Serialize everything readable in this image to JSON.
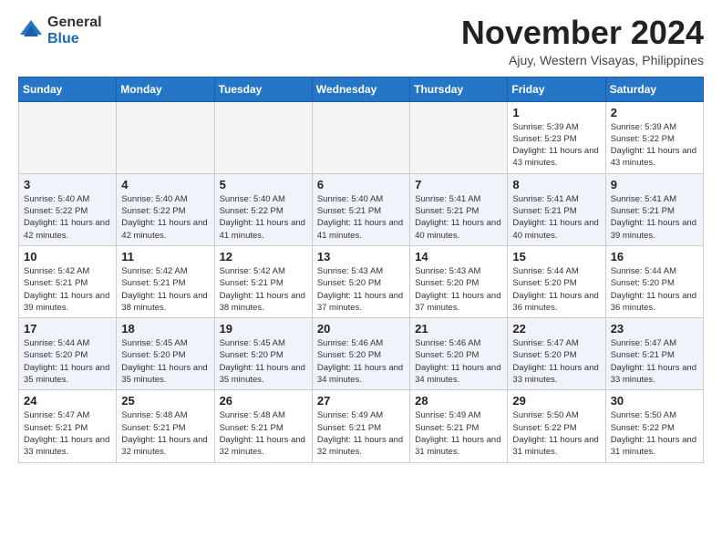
{
  "logo": {
    "general": "General",
    "blue": "Blue"
  },
  "header": {
    "month": "November 2024",
    "location": "Ajuy, Western Visayas, Philippines"
  },
  "weekdays": [
    "Sunday",
    "Monday",
    "Tuesday",
    "Wednesday",
    "Thursday",
    "Friday",
    "Saturday"
  ],
  "weeks": [
    [
      {
        "day": "",
        "empty": true
      },
      {
        "day": "",
        "empty": true
      },
      {
        "day": "",
        "empty": true
      },
      {
        "day": "",
        "empty": true
      },
      {
        "day": "",
        "empty": true
      },
      {
        "day": "1",
        "sunrise": "Sunrise: 5:39 AM",
        "sunset": "Sunset: 5:23 PM",
        "daylight": "Daylight: 11 hours and 43 minutes."
      },
      {
        "day": "2",
        "sunrise": "Sunrise: 5:39 AM",
        "sunset": "Sunset: 5:22 PM",
        "daylight": "Daylight: 11 hours and 43 minutes."
      }
    ],
    [
      {
        "day": "3",
        "sunrise": "Sunrise: 5:40 AM",
        "sunset": "Sunset: 5:22 PM",
        "daylight": "Daylight: 11 hours and 42 minutes."
      },
      {
        "day": "4",
        "sunrise": "Sunrise: 5:40 AM",
        "sunset": "Sunset: 5:22 PM",
        "daylight": "Daylight: 11 hours and 42 minutes."
      },
      {
        "day": "5",
        "sunrise": "Sunrise: 5:40 AM",
        "sunset": "Sunset: 5:22 PM",
        "daylight": "Daylight: 11 hours and 41 minutes."
      },
      {
        "day": "6",
        "sunrise": "Sunrise: 5:40 AM",
        "sunset": "Sunset: 5:21 PM",
        "daylight": "Daylight: 11 hours and 41 minutes."
      },
      {
        "day": "7",
        "sunrise": "Sunrise: 5:41 AM",
        "sunset": "Sunset: 5:21 PM",
        "daylight": "Daylight: 11 hours and 40 minutes."
      },
      {
        "day": "8",
        "sunrise": "Sunrise: 5:41 AM",
        "sunset": "Sunset: 5:21 PM",
        "daylight": "Daylight: 11 hours and 40 minutes."
      },
      {
        "day": "9",
        "sunrise": "Sunrise: 5:41 AM",
        "sunset": "Sunset: 5:21 PM",
        "daylight": "Daylight: 11 hours and 39 minutes."
      }
    ],
    [
      {
        "day": "10",
        "sunrise": "Sunrise: 5:42 AM",
        "sunset": "Sunset: 5:21 PM",
        "daylight": "Daylight: 11 hours and 39 minutes."
      },
      {
        "day": "11",
        "sunrise": "Sunrise: 5:42 AM",
        "sunset": "Sunset: 5:21 PM",
        "daylight": "Daylight: 11 hours and 38 minutes."
      },
      {
        "day": "12",
        "sunrise": "Sunrise: 5:42 AM",
        "sunset": "Sunset: 5:21 PM",
        "daylight": "Daylight: 11 hours and 38 minutes."
      },
      {
        "day": "13",
        "sunrise": "Sunrise: 5:43 AM",
        "sunset": "Sunset: 5:20 PM",
        "daylight": "Daylight: 11 hours and 37 minutes."
      },
      {
        "day": "14",
        "sunrise": "Sunrise: 5:43 AM",
        "sunset": "Sunset: 5:20 PM",
        "daylight": "Daylight: 11 hours and 37 minutes."
      },
      {
        "day": "15",
        "sunrise": "Sunrise: 5:44 AM",
        "sunset": "Sunset: 5:20 PM",
        "daylight": "Daylight: 11 hours and 36 minutes."
      },
      {
        "day": "16",
        "sunrise": "Sunrise: 5:44 AM",
        "sunset": "Sunset: 5:20 PM",
        "daylight": "Daylight: 11 hours and 36 minutes."
      }
    ],
    [
      {
        "day": "17",
        "sunrise": "Sunrise: 5:44 AM",
        "sunset": "Sunset: 5:20 PM",
        "daylight": "Daylight: 11 hours and 35 minutes."
      },
      {
        "day": "18",
        "sunrise": "Sunrise: 5:45 AM",
        "sunset": "Sunset: 5:20 PM",
        "daylight": "Daylight: 11 hours and 35 minutes."
      },
      {
        "day": "19",
        "sunrise": "Sunrise: 5:45 AM",
        "sunset": "Sunset: 5:20 PM",
        "daylight": "Daylight: 11 hours and 35 minutes."
      },
      {
        "day": "20",
        "sunrise": "Sunrise: 5:46 AM",
        "sunset": "Sunset: 5:20 PM",
        "daylight": "Daylight: 11 hours and 34 minutes."
      },
      {
        "day": "21",
        "sunrise": "Sunrise: 5:46 AM",
        "sunset": "Sunset: 5:20 PM",
        "daylight": "Daylight: 11 hours and 34 minutes."
      },
      {
        "day": "22",
        "sunrise": "Sunrise: 5:47 AM",
        "sunset": "Sunset: 5:20 PM",
        "daylight": "Daylight: 11 hours and 33 minutes."
      },
      {
        "day": "23",
        "sunrise": "Sunrise: 5:47 AM",
        "sunset": "Sunset: 5:21 PM",
        "daylight": "Daylight: 11 hours and 33 minutes."
      }
    ],
    [
      {
        "day": "24",
        "sunrise": "Sunrise: 5:47 AM",
        "sunset": "Sunset: 5:21 PM",
        "daylight": "Daylight: 11 hours and 33 minutes."
      },
      {
        "day": "25",
        "sunrise": "Sunrise: 5:48 AM",
        "sunset": "Sunset: 5:21 PM",
        "daylight": "Daylight: 11 hours and 32 minutes."
      },
      {
        "day": "26",
        "sunrise": "Sunrise: 5:48 AM",
        "sunset": "Sunset: 5:21 PM",
        "daylight": "Daylight: 11 hours and 32 minutes."
      },
      {
        "day": "27",
        "sunrise": "Sunrise: 5:49 AM",
        "sunset": "Sunset: 5:21 PM",
        "daylight": "Daylight: 11 hours and 32 minutes."
      },
      {
        "day": "28",
        "sunrise": "Sunrise: 5:49 AM",
        "sunset": "Sunset: 5:21 PM",
        "daylight": "Daylight: 11 hours and 31 minutes."
      },
      {
        "day": "29",
        "sunrise": "Sunrise: 5:50 AM",
        "sunset": "Sunset: 5:22 PM",
        "daylight": "Daylight: 11 hours and 31 minutes."
      },
      {
        "day": "30",
        "sunrise": "Sunrise: 5:50 AM",
        "sunset": "Sunset: 5:22 PM",
        "daylight": "Daylight: 11 hours and 31 minutes."
      }
    ]
  ]
}
